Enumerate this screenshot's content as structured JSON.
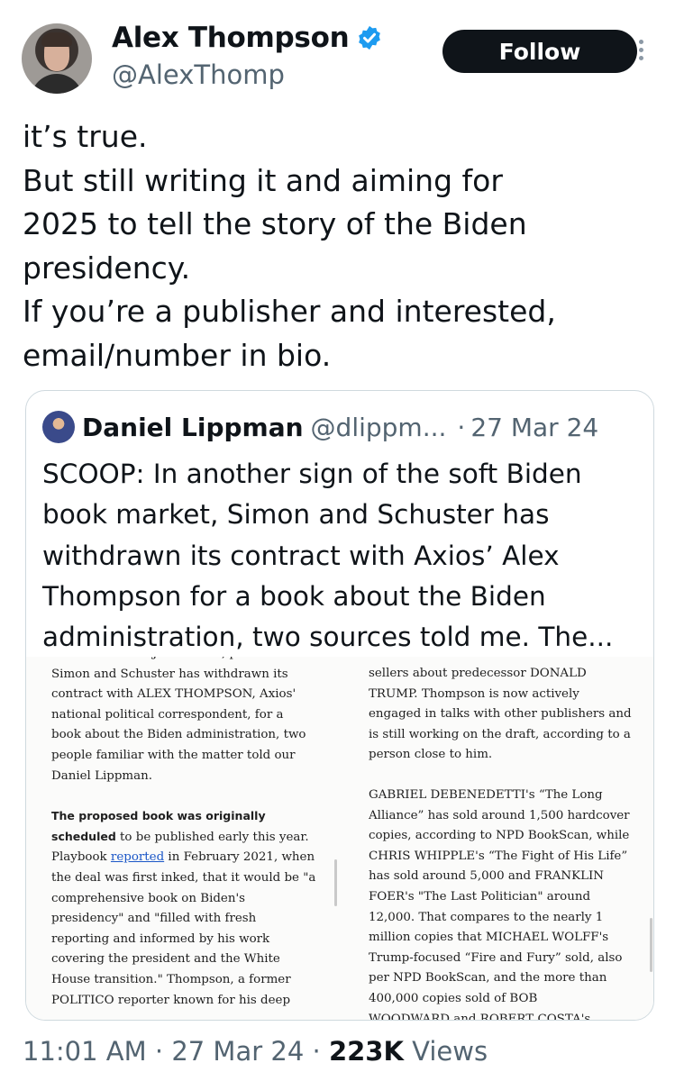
{
  "author": {
    "name": "Alex Thompson",
    "handle": "@AlexThomp",
    "verified": true,
    "verified_color": "#1d9bf0"
  },
  "follow_label": "Follow",
  "tweet_lines": [
    "it’s true.",
    "But still writing it and aiming for",
    "2025 to tell the story of the Biden",
    "presidency.",
    "If you’re a publisher and interested,",
    "email/number in bio."
  ],
  "quoted": {
    "name": "Daniel Lippman",
    "handle": "@dlippm...",
    "separator": "·",
    "date": "27 Mar 24",
    "text_lines": [
      "SCOOP: In another sign of the soft Biden",
      "book market, Simon and Schuster has",
      "withdrawn its contract with Axios’ Alex",
      "Thompson for a book about the Biden",
      "administration, two sources told me. The..."
    ],
    "article": {
      "left_top": [
        "about President JOE BIDEN, publisher",
        "Simon and Schuster has withdrawn its",
        "contract with ALEX THOMPSON, Axios'",
        "national political correspondent, for a",
        "book about the Biden administration, two",
        "people familiar with the matter told our",
        "Daniel Lippman."
      ],
      "left_bold_1": "The proposed book was originally",
      "left_bold_2": "scheduled",
      "left_after_bold_2": " to be published early this year.",
      "left_link_pre": "Playbook ",
      "left_link": "reported",
      "left_link_post": " in February 2021, when",
      "left_bottom": [
        "the deal was first inked, that it would be \"a",
        "comprehensive book on Biden's",
        "presidency\" and \"filled with fresh",
        "reporting and informed by his work",
        "covering the president and the White",
        "House transition.\" Thompson, a former",
        "POLITICO reporter known for his deep"
      ],
      "right_top": [
        "sellers about predecessor DONALD",
        "TRUMP. Thompson is now actively",
        "engaged in talks with other publishers and",
        "is still working on the draft, according to a",
        "person close to him."
      ],
      "right_bottom": [
        "GABRIEL DEBENEDETTI's “The Long",
        "Alliance” has sold around 1,500 hardcover",
        "copies, according to NPD BookScan, while",
        "CHRIS WHIPPLE's “The Fight of His Life”",
        "has sold around 5,000 and FRANKLIN",
        "FOER's \"The Last Politician\" around",
        "12,000. That compares to the nearly 1",
        "million copies that MICHAEL WOLFF's",
        "Trump-focused “Fire and Fury” sold, also",
        "per NPD BookScan, and the more than",
        "400,000 copies sold of BOB",
        "WOODWARD and ROBERT COSTA's"
      ]
    }
  },
  "footer": {
    "time": "11:01 AM",
    "sep1": " · ",
    "date": "27 Mar 24",
    "sep2": " · ",
    "views_count": "223K",
    "views_label": " Views"
  }
}
